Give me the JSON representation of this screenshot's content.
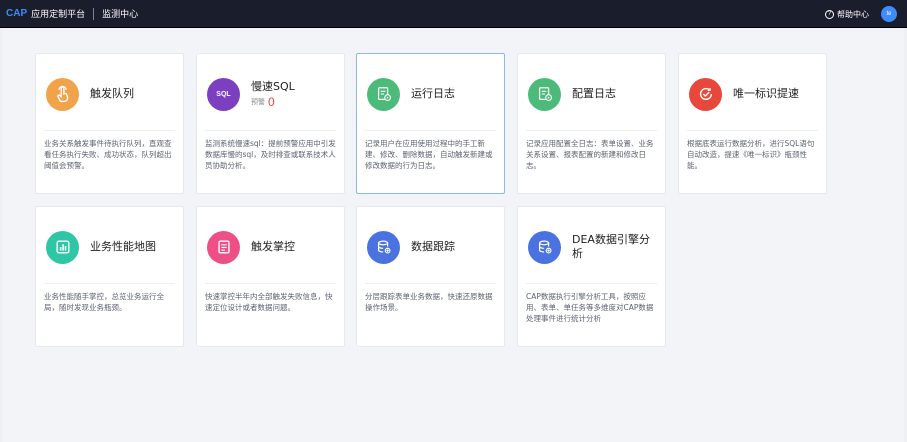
{
  "topbar": {
    "logo": "CAP",
    "app_name": "应用定制平台",
    "section": "监测中心",
    "help_label": "帮助中心",
    "avatar_text": "te"
  },
  "cards": [
    {
      "title": "触发队列",
      "icon": "hand-tap-icon",
      "color": "#f0a34a",
      "desc": "业务关系触发事件待执行队列，直观查看任务执行失败、成功状态，队列超出阈值会预警。"
    },
    {
      "title": "慢速SQL",
      "icon": "sql-icon",
      "color": "#7b3fc0",
      "alert_label": "预警",
      "alert_count": "0",
      "desc": "监测系统慢速sql：提前预警应用中引发数据库慢的sql，及时排查或联系技术人员协助分析。"
    },
    {
      "title": "运行日志",
      "icon": "run-log-icon",
      "color": "#4cbb7a",
      "desc": "记录用户在应用使用过程中的手工新建、修改、删除数据，自动触发新建或修改数据的行为日志。"
    },
    {
      "title": "配置日志",
      "icon": "config-log-icon",
      "color": "#4cbb7a",
      "desc": "记录应用配置全日志：表单设置、业务关系设置、报表配置的新建和修改日志。"
    },
    {
      "title": "唯一标识提速",
      "icon": "speed-check-icon",
      "color": "#e8473b",
      "desc": "根据底表运行数据分析，进行SQL语句自动改造，提速《唯一标识》瓶颈性能。"
    },
    {
      "title": "业务性能地图",
      "icon": "performance-chart-icon",
      "color": "#2fc6a6",
      "desc": "业务性能随手掌控，总览业务运行全局，随时发现业务瓶颈。"
    },
    {
      "title": "触发掌控",
      "icon": "trigger-list-icon",
      "color": "#ee4f86",
      "desc": "快速掌控半年内全部触发失败信息，快速定位设计或者数据问题。"
    },
    {
      "title": "数据跟踪",
      "icon": "database-search-icon",
      "color": "#4a72e0",
      "desc": "分层跟踪表单业务数据，快速还原数据操作场景。"
    },
    {
      "title": "DEA数据引擎分析",
      "icon": "database-engine-icon",
      "color": "#4a72e0",
      "desc": "CAP数据执行引擎分析工具，按照应用、表单、单任务等多维度对CAP数据处理事件进行统计分析"
    }
  ]
}
